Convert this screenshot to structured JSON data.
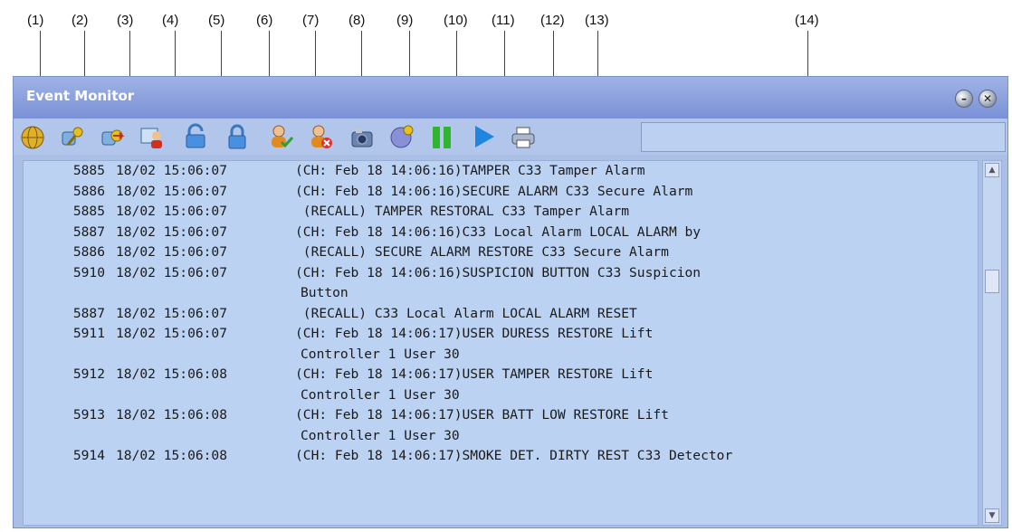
{
  "callouts": [
    "(1)",
    "(2)",
    "(3)",
    "(4)",
    "(5)",
    "(6)",
    "(7)",
    "(8)",
    "(9)",
    "(10)",
    "(11)",
    "(12)",
    "(13)",
    "(14)"
  ],
  "window": {
    "title": "Event Monitor"
  },
  "log": [
    {
      "num": "5885",
      "dt": "18/02 15:06:07",
      "msg": "(CH: Feb 18 14:06:16)TAMPER C33 Tamper Alarm"
    },
    {
      "num": "5886",
      "dt": "18/02 15:06:07",
      "msg": "(CH: Feb 18 14:06:16)SECURE ALARM C33 Secure Alarm"
    },
    {
      "num": "5885",
      "dt": "18/02 15:06:07",
      "msg": " (RECALL) TAMPER RESTORAL C33 Tamper Alarm"
    },
    {
      "num": "5887",
      "dt": "18/02 15:06:07",
      "msg": "(CH: Feb 18 14:06:16)C33 Local Alarm LOCAL ALARM by"
    },
    {
      "num": "5886",
      "dt": "18/02 15:06:07",
      "msg": " (RECALL) SECURE ALARM RESTORE C33 Secure Alarm"
    },
    {
      "num": "5910",
      "dt": "18/02 15:06:07",
      "msg": "(CH: Feb 18 14:06:16)SUSPICION BUTTON C33 Suspicion"
    },
    {
      "num": "",
      "dt": "",
      "msg": "Button"
    },
    {
      "num": "5887",
      "dt": "18/02 15:06:07",
      "msg": " (RECALL) C33 Local Alarm LOCAL ALARM RESET"
    },
    {
      "num": "5911",
      "dt": "18/02 15:06:07",
      "msg": "(CH: Feb 18 14:06:17)USER DURESS RESTORE Lift"
    },
    {
      "num": "",
      "dt": "",
      "msg": "Controller 1 User 30"
    },
    {
      "num": "5912",
      "dt": "18/02 15:06:08",
      "msg": "(CH: Feb 18 14:06:17)USER TAMPER RESTORE Lift"
    },
    {
      "num": "",
      "dt": "",
      "msg": "Controller 1 User 30"
    },
    {
      "num": "5913",
      "dt": "18/02 15:06:08",
      "msg": "(CH: Feb 18 14:06:17)USER BATT LOW RESTORE Lift"
    },
    {
      "num": "",
      "dt": "",
      "msg": "Controller 1 User 30"
    },
    {
      "num": "5914",
      "dt": "18/02 15:06:08",
      "msg": "(CH: Feb 18 14:06:17)SMOKE DET. DIRTY REST C33 Detector"
    }
  ],
  "toolbar_icons": [
    "globe-icon",
    "keys-icon",
    "keys-arrow-icon",
    "user-screen-icon",
    "unlock-icon",
    "lock-icon",
    "user-check-icon",
    "user-cancel-icon",
    "camera-icon",
    "globe-gear-icon",
    "pause-icon",
    "play-icon",
    "printer-icon"
  ],
  "colors": {
    "titlebar": "#8ea3e0",
    "log_bg": "#bcd2f3",
    "pause": "#2fb52f",
    "play": "#1f86e0"
  }
}
